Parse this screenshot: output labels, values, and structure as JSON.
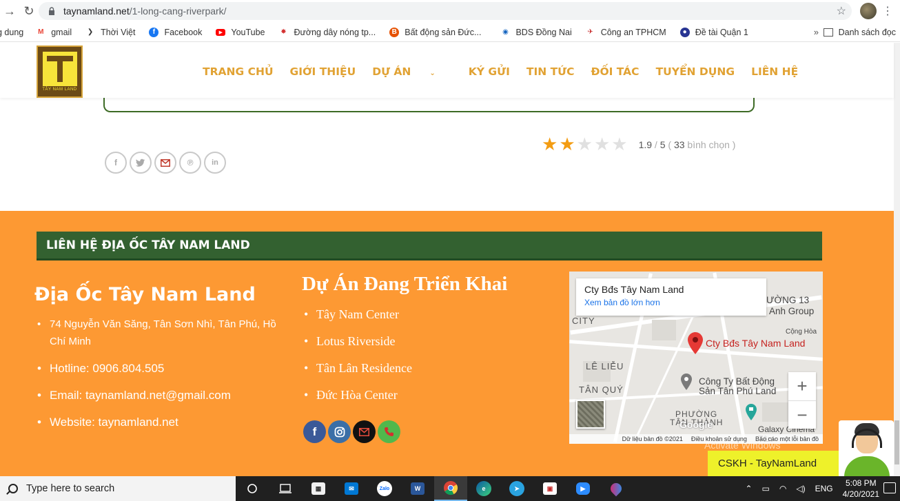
{
  "browser": {
    "url_host": "taynamland.net",
    "url_path": "/1-long-cang-riverpark/",
    "bookmarks": [
      {
        "label": "g dung",
        "icon": "apps-icon",
        "color": ""
      },
      {
        "label": "gmail",
        "icon": "gmail-icon",
        "color": "#ea4335"
      },
      {
        "label": "Thời Việt",
        "icon": "thoiviet-icon",
        "color": "#333333"
      },
      {
        "label": "Facebook",
        "icon": "facebook-icon",
        "color": "#1877f2"
      },
      {
        "label": "YouTube",
        "icon": "youtube-icon",
        "color": "#ff0000"
      },
      {
        "label": "Đường dây nóng tp...",
        "icon": "emblem-icon",
        "color": "#d32f2f"
      },
      {
        "label": "Bất động sản Đức...",
        "icon": "realestate-icon",
        "color": "#e65100"
      },
      {
        "label": "BDS Đồng Nai",
        "icon": "bds-icon",
        "color": "#1565c0"
      },
      {
        "label": "Công an TPHCM",
        "icon": "police-icon",
        "color": "#c62828"
      },
      {
        "label": "Đề tài Quận 1",
        "icon": "district-icon",
        "color": "#283593"
      }
    ],
    "more": "»",
    "reading_list": "Danh sách đọc"
  },
  "site": {
    "logo_text": "TÂY NAM LAND",
    "nav": [
      "TRANG CHỦ",
      "GIỚI THIỆU",
      "DỰ ÁN",
      "KÝ GỬI",
      "TIN TỨC",
      "ĐỐI TÁC",
      "TUYỂN DỤNG",
      "LIÊN HỆ"
    ]
  },
  "rating": {
    "value": 1.9,
    "score": "1.9",
    "sep": "/",
    "max": "5",
    "votes_open": "(",
    "votes": "33",
    "votes_label": "bình chọn )",
    "stars_filled": 2,
    "stars_total": 5
  },
  "share": [
    "facebook-icon",
    "twitter-icon",
    "email-icon",
    "pinterest-icon",
    "linkedin-icon"
  ],
  "footer": {
    "contact_bar": "LIÊN HỆ ĐỊA ỐC TÂY NAM LAND",
    "company_title": "Địa Ốc Tây Nam Land",
    "contact_items": [
      "74 Nguyễn Văn Săng, Tân Sơn Nhì, Tân Phú, Hồ Chí Minh",
      "Hotline: 0906.804.505",
      "Email: taynamland.net@gmail.com",
      "Website: taynamland.net"
    ],
    "projects_title": "Dự Án Đang Triển Khai",
    "projects": [
      "Tây Nam Center",
      "Lotus Riverside",
      "Tân Lân Residence",
      "Đức Hòa Center"
    ]
  },
  "map": {
    "info_title": "Cty Bđs Tây Nam Land",
    "info_link": "Xem bản đồ lớn hơn",
    "pin_label": "Cty Bđs Tây Nam Land",
    "labels": [
      "ƯỜNG 13",
      "Anh Group",
      "CITY",
      "Cộng Hòa",
      "LÊ LIỄU",
      "TÂN QUÝ",
      "PHƯỜNG",
      "TÂN THÀNH",
      "Công Ty Bất Động",
      "Sản Tân Phú Land",
      "Galaxy Cinema Tân"
    ],
    "zoom_in": "+",
    "zoom_out": "−",
    "google": "Google",
    "footer": [
      "Dữ liệu bản đồ ©2021",
      "Điều khoản sử dụng",
      "Báo cáo một lỗi bản đồ"
    ]
  },
  "watermark": "Activate Windows",
  "cskh": "CSKH - TayNamLand",
  "taskbar": {
    "search_placeholder": "Type here to search",
    "lang": "ENG",
    "time": "5:08 PM",
    "date": "4/20/2021"
  }
}
